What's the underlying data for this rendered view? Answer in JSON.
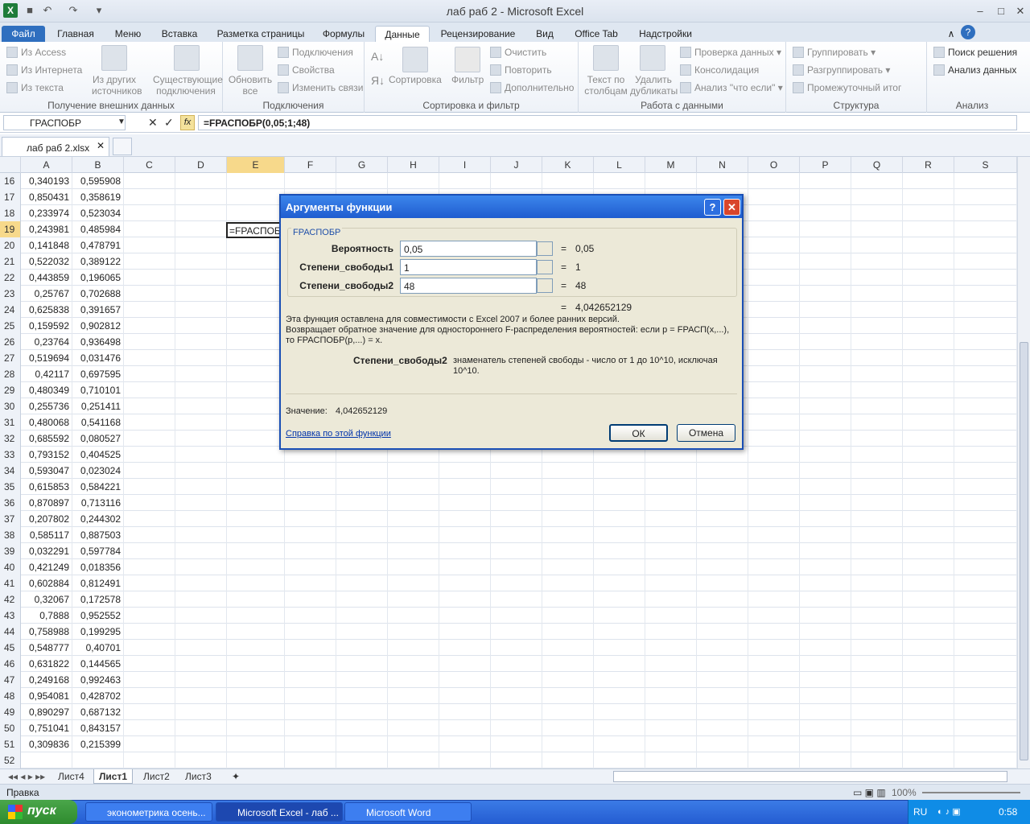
{
  "window": {
    "title": "лаб раб 2  -  Microsoft Excel"
  },
  "ribbon_tabs": [
    "Файл",
    "Главная",
    "Меню",
    "Вставка",
    "Разметка страницы",
    "Формулы",
    "Данные",
    "Рецензирование",
    "Вид",
    "Office Tab",
    "Надстройки"
  ],
  "ribbon": {
    "external": {
      "access": "Из Access",
      "web": "Из Интернета",
      "text": "Из текста",
      "other1": "Из других",
      "other2": "источников",
      "exist1": "Существующие",
      "exist2": "подключения",
      "label": "Получение внешних данных"
    },
    "connections": {
      "refresh1": "Обновить",
      "refresh2": "все",
      "conn": "Подключения",
      "props": "Свойства",
      "links": "Изменить связи",
      "label": "Подключения"
    },
    "sort": {
      "sort": "Сортировка",
      "filter": "Фильтр",
      "clear": "Очистить",
      "reapply": "Повторить",
      "advanced": "Дополнительно",
      "label": "Сортировка и фильтр"
    },
    "data": {
      "ttc1": "Текст по",
      "ttc2": "столбцам",
      "dup1": "Удалить",
      "dup2": "дубликаты",
      "validation": "Проверка данных",
      "consolidate": "Консолидация",
      "whatif": "Анализ \"что если\"",
      "label": "Работа с данными"
    },
    "outline": {
      "group": "Группировать",
      "ungroup": "Разгруппировать",
      "subtotal": "Промежуточный итог",
      "label": "Структура"
    },
    "analysis": {
      "solver": "Поиск решения",
      "datan": "Анализ данных",
      "label": "Анализ"
    }
  },
  "formula_bar": {
    "name": "ГРАСПОБР",
    "formula": "=FРАСПОБР(0,05;1;48)",
    "fx": "fx"
  },
  "file_tab": "лаб раб 2.xlsx",
  "columns": [
    "A",
    "B",
    "C",
    "D",
    "E",
    "F",
    "G",
    "H",
    "I",
    "J",
    "K",
    "L",
    "M",
    "N",
    "O",
    "P",
    "Q",
    "R",
    "S"
  ],
  "rows": [
    {
      "n": "16",
      "a": "0,340193",
      "b": "0,595908"
    },
    {
      "n": "17",
      "a": "0,850431",
      "b": "0,358619"
    },
    {
      "n": "18",
      "a": "0,233974",
      "b": "0,523034"
    },
    {
      "n": "19",
      "a": "0,243981",
      "b": "0,485984"
    },
    {
      "n": "20",
      "a": "0,141848",
      "b": "0,478791"
    },
    {
      "n": "21",
      "a": "0,522032",
      "b": "0,389122"
    },
    {
      "n": "22",
      "a": "0,443859",
      "b": "0,196065"
    },
    {
      "n": "23",
      "a": "0,25767",
      "b": "0,702688"
    },
    {
      "n": "24",
      "a": "0,625838",
      "b": "0,391657"
    },
    {
      "n": "25",
      "a": "0,159592",
      "b": "0,902812"
    },
    {
      "n": "26",
      "a": "0,23764",
      "b": "0,936498"
    },
    {
      "n": "27",
      "a": "0,519694",
      "b": "0,031476"
    },
    {
      "n": "28",
      "a": "0,42117",
      "b": "0,697595"
    },
    {
      "n": "29",
      "a": "0,480349",
      "b": "0,710101"
    },
    {
      "n": "30",
      "a": "0,255736",
      "b": "0,251411"
    },
    {
      "n": "31",
      "a": "0,480068",
      "b": "0,541168"
    },
    {
      "n": "32",
      "a": "0,685592",
      "b": "0,080527"
    },
    {
      "n": "33",
      "a": "0,793152",
      "b": "0,404525"
    },
    {
      "n": "34",
      "a": "0,593047",
      "b": "0,023024"
    },
    {
      "n": "35",
      "a": "0,615853",
      "b": "0,584221"
    },
    {
      "n": "36",
      "a": "0,870897",
      "b": "0,713116"
    },
    {
      "n": "37",
      "a": "0,207802",
      "b": "0,244302"
    },
    {
      "n": "38",
      "a": "0,585117",
      "b": "0,887503"
    },
    {
      "n": "39",
      "a": "0,032291",
      "b": "0,597784"
    },
    {
      "n": "40",
      "a": "0,421249",
      "b": "0,018356"
    },
    {
      "n": "41",
      "a": "0,602884",
      "b": "0,812491"
    },
    {
      "n": "42",
      "a": "0,32067",
      "b": "0,172578"
    },
    {
      "n": "43",
      "a": "0,7888",
      "b": "0,952552"
    },
    {
      "n": "44",
      "a": "0,758988",
      "b": "0,199295"
    },
    {
      "n": "45",
      "a": "0,548777",
      "b": "0,40701"
    },
    {
      "n": "46",
      "a": "0,631822",
      "b": "0,144565"
    },
    {
      "n": "47",
      "a": "0,249168",
      "b": "0,992463"
    },
    {
      "n": "48",
      "a": "0,954081",
      "b": "0,428702"
    },
    {
      "n": "49",
      "a": "0,890297",
      "b": "0,687132"
    },
    {
      "n": "50",
      "a": "0,751041",
      "b": "0,843157"
    },
    {
      "n": "51",
      "a": "0,309836",
      "b": "0,215399"
    },
    {
      "n": "52",
      "a": "",
      "b": ""
    }
  ],
  "active_cell_text": "=FРАСПОБ",
  "sheets": [
    "Лист4",
    "Лист1",
    "Лист2",
    "Лист3"
  ],
  "status": {
    "mode": "Правка",
    "zoom": "100%"
  },
  "dialog": {
    "title": "Аргументы функции",
    "func": "FРАСПОБР",
    "args": [
      {
        "label": "Вероятность",
        "value": "0,05",
        "result": "0,05"
      },
      {
        "label": "Степени_свободы1",
        "value": "1",
        "result": "1"
      },
      {
        "label": "Степени_свободы2",
        "value": "48",
        "result": "48"
      }
    ],
    "eq": "=",
    "total": "4,042652129",
    "desc1": "Эта функция оставлена для совместимости с Excel 2007 и более ранних версий.",
    "desc2": "Возвращает обратное значение для одностороннего F-распределения вероятностей: если p = FРАСП(x,...),",
    "desc3": "то FРАСПОБР(p,...) = x.",
    "arg_name": "Степени_свободы2",
    "arg_desc1": "знаменатель степеней свободы - число от 1 до 10^10, исключая",
    "arg_desc2": "10^10.",
    "value_label": "Значение:",
    "value": "4,042652129",
    "help": "Справка по этой функции",
    "ok": "ОК",
    "cancel": "Отмена"
  },
  "taskbar": {
    "start": "пуск",
    "items": [
      "эконометрика осень...",
      "Microsoft Excel - лаб ...",
      "Microsoft Word"
    ],
    "lang": "RU",
    "time": "0:58"
  }
}
